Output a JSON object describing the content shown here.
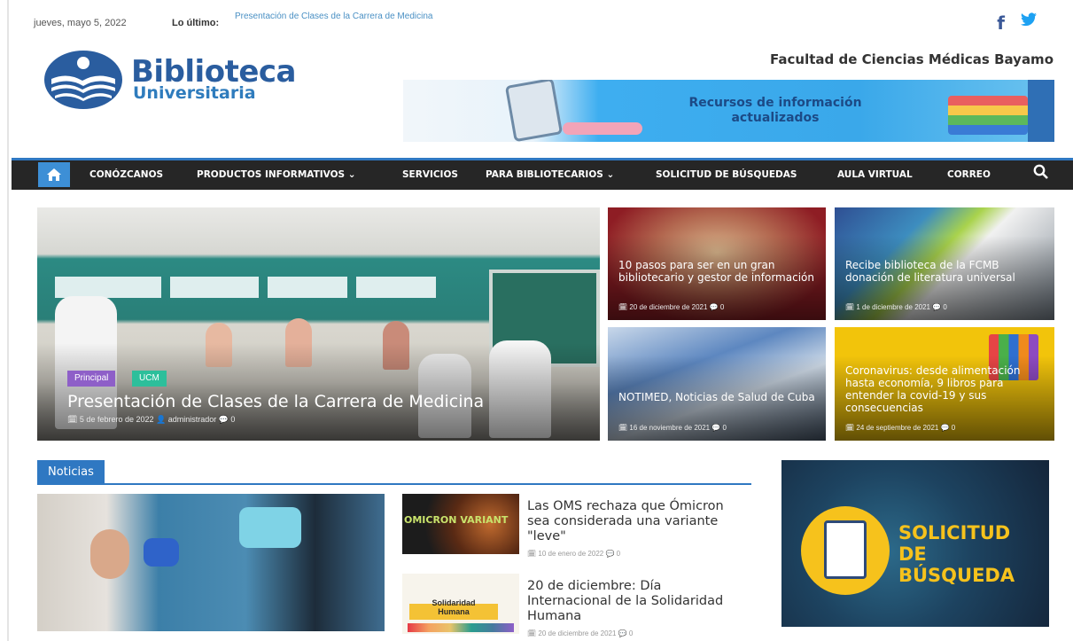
{
  "topbar": {
    "date": "jueves, mayo 5, 2022",
    "latest_label": "Lo último:",
    "latest_text": "Presentación de Clases de la Carrera de Medicina",
    "social": [
      "f",
      "🐦"
    ]
  },
  "header": {
    "logo_title": "Biblioteca",
    "logo_subtitle": "Universitaria",
    "faculty": "Facultad de Ciencias Médicas Bayamo",
    "banner_text": "Recursos de información actualizados"
  },
  "nav": {
    "home_icon": "home-icon",
    "items": [
      "CONÓZCANOS",
      "PRODUCTOS INFORMATIVOS ⌄",
      "SERVICIOS",
      "PARA BIBLIOTECARIOS ⌄",
      "SOLICITUD DE BÚSQUEDAS",
      "AULA VIRTUAL",
      "CORREO"
    ],
    "search_icon": "search-icon"
  },
  "featured": {
    "main": {
      "tags": [
        "Principal",
        "UCM"
      ],
      "title": "Presentación de Clases de la Carrera de Medicina",
      "meta": "🗓 5 de febrero de 2022   👤 administrador   💬 0"
    },
    "tiles": [
      {
        "title": "10 pasos para ser en un gran bibliotecario y gestor de información",
        "meta": "🗓 20 de diciembre de 2021   💬 0"
      },
      {
        "title": "Recibe biblioteca de la FCMB donación de literatura universal",
        "meta": "🗓 1 de diciembre de 2021   💬 0"
      },
      {
        "title": "NOTIMED, Noticias de Salud de Cuba",
        "meta": "🗓 16 de noviembre de 2021   💬 0"
      },
      {
        "title": "Coronavirus: desde alimentación hasta economía, 9 libros para entender la covid-19 y sus consecuencias",
        "meta": "🗓 24 de septiembre de 2021   💬 0"
      }
    ]
  },
  "news": {
    "heading": "Noticias",
    "items": [
      {
        "title": "Las OMS rechaza que Ómicron sea considerada una variante \"leve\"",
        "meta": "🗓 10 de enero de 2022   💬 0",
        "thumb_text": "OMICRON VARIANT"
      },
      {
        "title": "20 de diciembre: Día Internacional de la Solidaridad Humana",
        "meta": "🗓 20 de diciembre de 2021   💬 0",
        "thumb_text": "Solidaridad Humana"
      }
    ]
  },
  "sidebar": {
    "ad_text": "SOLICITUD DE BÚSQUEDA"
  },
  "colors": {
    "accent": "#2f78c2",
    "nav_bg": "#262626",
    "tag_principal": "#8e5fc8",
    "tag_ucm": "#2dbf9b"
  }
}
